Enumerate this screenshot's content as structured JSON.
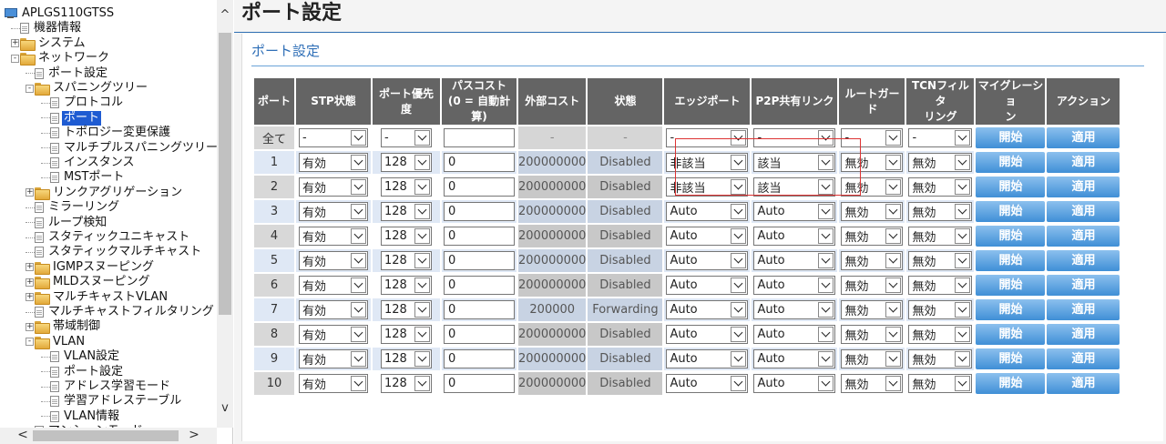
{
  "tree": {
    "nodes": [
      {
        "label": "APLGS110GTSS",
        "icon": "switch-icon",
        "expander": "",
        "level": 0
      },
      {
        "label": "機器情報",
        "icon": "document-icon",
        "expander": "",
        "level": 1
      },
      {
        "label": "システム",
        "icon": "folder-icon",
        "expander": "+",
        "level": 1
      },
      {
        "label": "ネットワーク",
        "icon": "folder-open-icon",
        "expander": "-",
        "level": 1
      },
      {
        "label": "ポート設定",
        "icon": "document-icon",
        "expander": "",
        "level": 2
      },
      {
        "label": "スパニングツリー",
        "icon": "folder-open-icon",
        "expander": "-",
        "level": 2
      },
      {
        "label": "プロトコル",
        "icon": "document-icon",
        "expander": "",
        "level": 3
      },
      {
        "label": "ポート",
        "icon": "document-icon",
        "expander": "",
        "level": 3,
        "selected": true
      },
      {
        "label": "トポロジー変更保護",
        "icon": "document-icon",
        "expander": "",
        "level": 3
      },
      {
        "label": "マルチプルスパニングツリー",
        "icon": "document-icon",
        "expander": "",
        "level": 3
      },
      {
        "label": "インスタンス",
        "icon": "document-icon",
        "expander": "",
        "level": 3
      },
      {
        "label": "MSTポート",
        "icon": "document-icon",
        "expander": "",
        "level": 3
      },
      {
        "label": "リンクアグリゲーション",
        "icon": "folder-icon",
        "expander": "+",
        "level": 2
      },
      {
        "label": "ミラーリング",
        "icon": "document-icon",
        "expander": "",
        "level": 2
      },
      {
        "label": "ループ検知",
        "icon": "document-icon",
        "expander": "",
        "level": 2
      },
      {
        "label": "スタティックユニキャスト",
        "icon": "document-icon",
        "expander": "",
        "level": 2
      },
      {
        "label": "スタティックマルチキャスト",
        "icon": "document-icon",
        "expander": "",
        "level": 2
      },
      {
        "label": "IGMPスヌーピング",
        "icon": "folder-icon",
        "expander": "+",
        "level": 2
      },
      {
        "label": "MLDスヌーピング",
        "icon": "folder-icon",
        "expander": "+",
        "level": 2
      },
      {
        "label": "マルチキャストVLAN",
        "icon": "folder-icon",
        "expander": "+",
        "level": 2
      },
      {
        "label": "マルチキャストフィルタリング",
        "icon": "document-icon",
        "expander": "",
        "level": 2
      },
      {
        "label": "帯域制御",
        "icon": "folder-icon",
        "expander": "+",
        "level": 2
      },
      {
        "label": "VLAN",
        "icon": "folder-open-icon",
        "expander": "-",
        "level": 2
      },
      {
        "label": "VLAN設定",
        "icon": "document-icon",
        "expander": "",
        "level": 3
      },
      {
        "label": "ポート設定",
        "icon": "document-icon",
        "expander": "",
        "level": 3
      },
      {
        "label": "アドレス学習モード",
        "icon": "document-icon",
        "expander": "",
        "level": 3
      },
      {
        "label": "学習アドレステーブル",
        "icon": "document-icon",
        "expander": "",
        "level": 3
      },
      {
        "label": "VLAN情報",
        "icon": "document-icon",
        "expander": "",
        "level": 3
      },
      {
        "label": "マンションモード",
        "icon": "document-icon",
        "expander": "",
        "level": 2
      }
    ],
    "scroll_up": "^",
    "scroll_down": "v",
    "scroll_left": "<",
    "scroll_right": ">"
  },
  "page": {
    "title": "ポート設定",
    "section_title": "ポート設定"
  },
  "table": {
    "headers": [
      "ポート",
      "STP状態",
      "ポート優先度",
      "パスコスト\n(0 = 自動計算)",
      "外部コスト",
      "状態",
      "エッジポート",
      "P2P共有リンク",
      "ルートガード",
      "TCNフィルタ\nリング",
      "マイグレーショ\nン",
      "アクション"
    ],
    "all_row": {
      "port": "全て",
      "stp": "-",
      "priority": "-",
      "path_cost": "",
      "ext_cost": "-",
      "state": "-",
      "edge": "-",
      "p2p": "-",
      "root_guard": "-",
      "tcn": "-",
      "migration_label": "開始",
      "action_label": "適用"
    },
    "rows": [
      {
        "port": "1",
        "stp": "有効",
        "priority": "128",
        "path_cost": "0",
        "ext_cost": "200000000",
        "state": "Disabled",
        "edge": "非該当",
        "p2p": "該当",
        "root_guard": "無効",
        "tcn": "無効",
        "migration_label": "開始",
        "action_label": "適用"
      },
      {
        "port": "2",
        "stp": "有効",
        "priority": "128",
        "path_cost": "0",
        "ext_cost": "200000000",
        "state": "Disabled",
        "edge": "非該当",
        "p2p": "該当",
        "root_guard": "無効",
        "tcn": "無効",
        "migration_label": "開始",
        "action_label": "適用"
      },
      {
        "port": "3",
        "stp": "有効",
        "priority": "128",
        "path_cost": "0",
        "ext_cost": "200000000",
        "state": "Disabled",
        "edge": "Auto",
        "p2p": "Auto",
        "root_guard": "無効",
        "tcn": "無効",
        "migration_label": "開始",
        "action_label": "適用"
      },
      {
        "port": "4",
        "stp": "有効",
        "priority": "128",
        "path_cost": "0",
        "ext_cost": "200000000",
        "state": "Disabled",
        "edge": "Auto",
        "p2p": "Auto",
        "root_guard": "無効",
        "tcn": "無効",
        "migration_label": "開始",
        "action_label": "適用"
      },
      {
        "port": "5",
        "stp": "有効",
        "priority": "128",
        "path_cost": "0",
        "ext_cost": "200000000",
        "state": "Disabled",
        "edge": "Auto",
        "p2p": "Auto",
        "root_guard": "無効",
        "tcn": "無効",
        "migration_label": "開始",
        "action_label": "適用"
      },
      {
        "port": "6",
        "stp": "有効",
        "priority": "128",
        "path_cost": "0",
        "ext_cost": "200000000",
        "state": "Disabled",
        "edge": "Auto",
        "p2p": "Auto",
        "root_guard": "無効",
        "tcn": "無効",
        "migration_label": "開始",
        "action_label": "適用"
      },
      {
        "port": "7",
        "stp": "有効",
        "priority": "128",
        "path_cost": "0",
        "ext_cost": "200000",
        "state": "Forwarding",
        "edge": "Auto",
        "p2p": "Auto",
        "root_guard": "無効",
        "tcn": "無効",
        "migration_label": "開始",
        "action_label": "適用"
      },
      {
        "port": "8",
        "stp": "有効",
        "priority": "128",
        "path_cost": "0",
        "ext_cost": "200000000",
        "state": "Disabled",
        "edge": "Auto",
        "p2p": "Auto",
        "root_guard": "無効",
        "tcn": "無効",
        "migration_label": "開始",
        "action_label": "適用"
      },
      {
        "port": "9",
        "stp": "有効",
        "priority": "128",
        "path_cost": "0",
        "ext_cost": "200000000",
        "state": "Disabled",
        "edge": "Auto",
        "p2p": "Auto",
        "root_guard": "無効",
        "tcn": "無効",
        "migration_label": "開始",
        "action_label": "適用"
      },
      {
        "port": "10",
        "stp": "有効",
        "priority": "128",
        "path_cost": "0",
        "ext_cost": "200000000",
        "state": "Disabled",
        "edge": "Auto",
        "p2p": "Auto",
        "root_guard": "無効",
        "tcn": "無効",
        "migration_label": "開始",
        "action_label": "適用"
      }
    ]
  },
  "colors": {
    "accent": "#2e6fb3",
    "header_bg": "#646464",
    "button_top": "#8cc0ee",
    "button_bottom": "#3f8fd6",
    "selected_tree_item": "#1e5bd2",
    "highlight_border": "#dd3333"
  }
}
